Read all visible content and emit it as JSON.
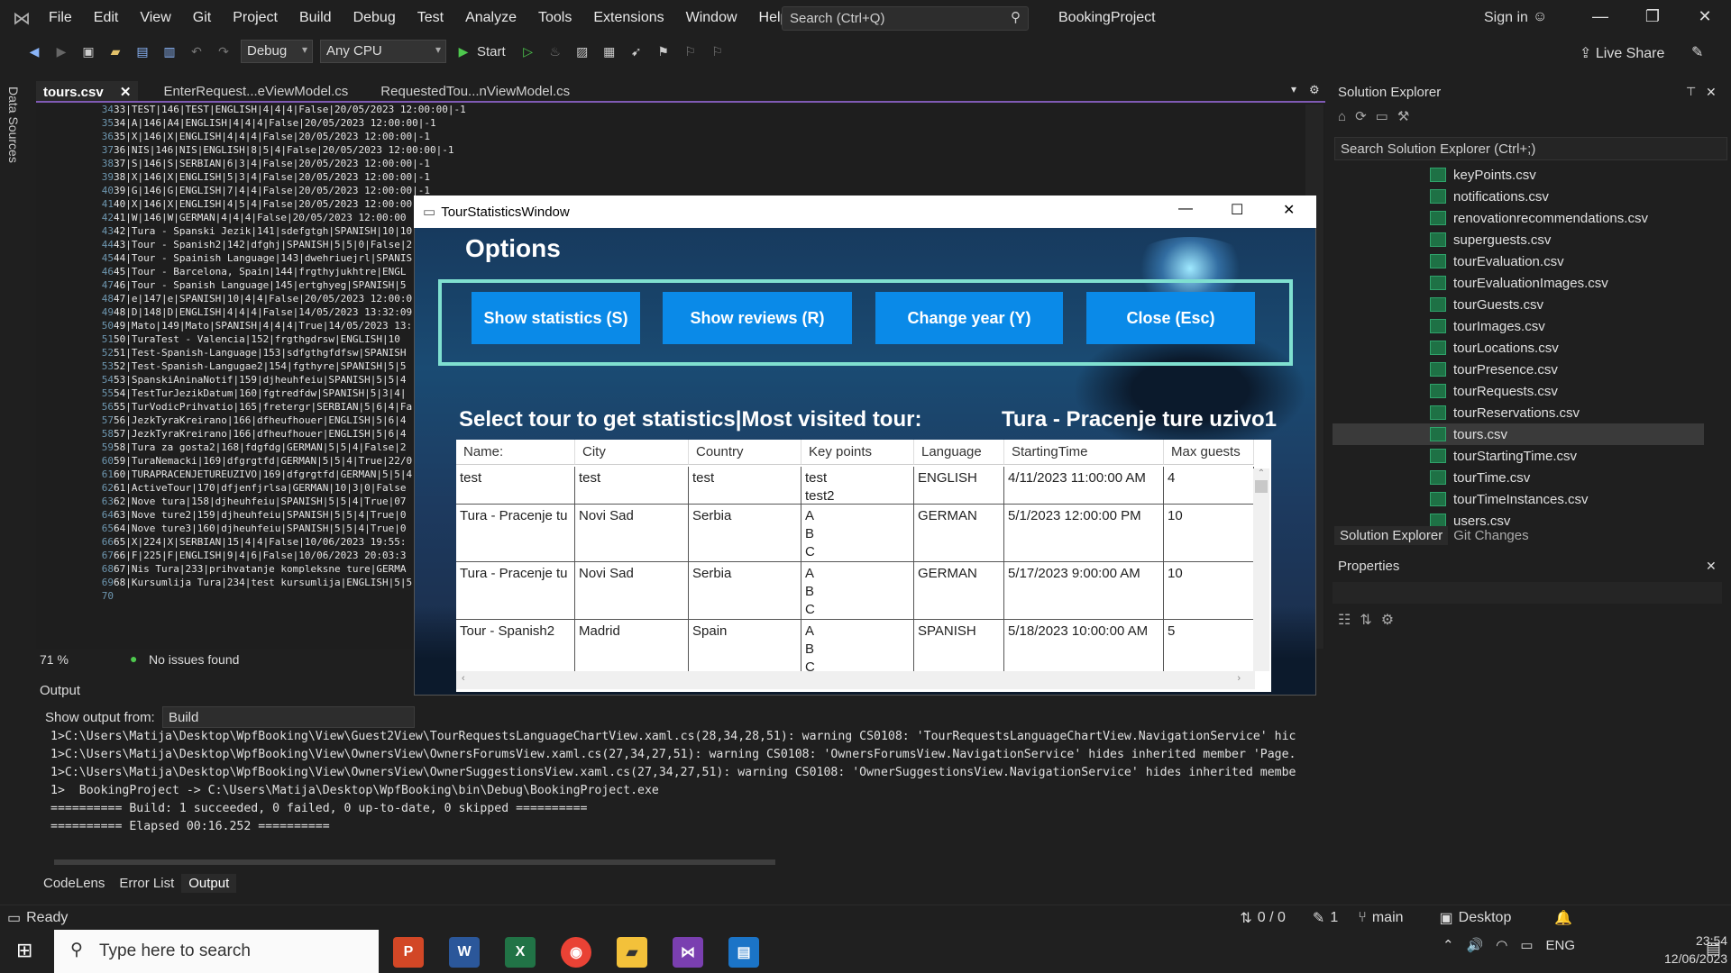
{
  "titlebar": {
    "menu": [
      "File",
      "Edit",
      "View",
      "Git",
      "Project",
      "Build",
      "Debug",
      "Test",
      "Analyze",
      "Tools",
      "Extensions",
      "Window",
      "Help"
    ],
    "search": "Search (Ctrl+Q)",
    "project": "BookingProject",
    "signin": "Sign in"
  },
  "toolbar": {
    "config": "Debug",
    "platform": "Any CPU",
    "start": "Start",
    "liveshare": "Live Share"
  },
  "sidebar": {
    "label": "Data Sources"
  },
  "tabs": [
    {
      "label": "tours.csv",
      "active": true
    },
    {
      "label": "EnterRequest...eViewModel.cs"
    },
    {
      "label": "RequestedTou...nViewModel.cs"
    }
  ],
  "editor": {
    "lines": [
      {
        "n": "34",
        "t": "33|TEST|146|TEST|ENGLISH|4|4|4|False|20/05/2023 12:00:00|-1"
      },
      {
        "n": "35",
        "t": "34|A|146|A4|ENGLISH|4|4|4|False|20/05/2023 12:00:00|-1"
      },
      {
        "n": "36",
        "t": "35|X|146|X|ENGLISH|4|4|4|False|20/05/2023 12:00:00|-1"
      },
      {
        "n": "37",
        "t": "36|NIS|146|NIS|ENGLISH|8|5|4|False|20/05/2023 12:00:00|-1"
      },
      {
        "n": "38",
        "t": "37|S|146|S|SERBIAN|6|3|4|False|20/05/2023 12:00:00|-1"
      },
      {
        "n": "39",
        "t": "38|X|146|X|ENGLISH|5|3|4|False|20/05/2023 12:00:00|-1"
      },
      {
        "n": "40",
        "t": "39|G|146|G|ENGLISH|7|4|4|False|20/05/2023 12:00:00|-1"
      },
      {
        "n": "41",
        "t": "40|X|146|X|ENGLISH|4|5|4|False|20/05/2023 12:00:00"
      },
      {
        "n": "42",
        "t": "41|W|146|W|GERMAN|4|4|4|False|20/05/2023 12:00:00"
      },
      {
        "n": "43",
        "t": "42|Tura - Spanski Jezik|141|sdefgtgh|SPANISH|10|10"
      },
      {
        "n": "44",
        "t": "43|Tour - Spanish2|142|dfghj|SPANISH|5|5|0|False|2"
      },
      {
        "n": "45",
        "t": "44|Tour - Spainish Language|143|dwehriuejrl|SPANIS"
      },
      {
        "n": "46",
        "t": "45|Tour - Barcelona, Spain|144|frgthyjukhtre|ENGL"
      },
      {
        "n": "47",
        "t": "46|Tour - Spanish Language|145|ertghyeg|SPANISH|5"
      },
      {
        "n": "48",
        "t": "47|e|147|e|SPANISH|10|4|4|False|20/05/2023 12:00:0"
      },
      {
        "n": "49",
        "t": "48|D|148|D|ENGLISH|4|4|4|False|14/05/2023 13:32:09"
      },
      {
        "n": "50",
        "t": "49|Mato|149|Mato|SPANISH|4|4|4|True|14/05/2023 13:"
      },
      {
        "n": "51",
        "t": "50|TuraTest - Valencia|152|frgthgdrsw|ENGLISH|10"
      },
      {
        "n": "52",
        "t": "51|Test-Spanish-Language|153|sdfgthgfdfsw|SPANISH"
      },
      {
        "n": "53",
        "t": "52|Test-Spanish-Langugae2|154|fgthyre|SPANISH|5|5"
      },
      {
        "n": "54",
        "t": "53|SpanskiAninaNotif|159|djheuhfeiu|SPANISH|5|5|4"
      },
      {
        "n": "55",
        "t": "54|TestTurJezikDatum|160|fgtredfdw|SPANISH|5|3|4|"
      },
      {
        "n": "56",
        "t": "55|TurVodicPrihvatio|165|fretergr|SERBIAN|5|6|4|Fa"
      },
      {
        "n": "57",
        "t": "56|JezkTyraKreirano|166|dfheufhouer|ENGLISH|5|6|4"
      },
      {
        "n": "58",
        "t": "57|JezkTyraKreirano|166|dfheufhouer|ENGLISH|5|6|4"
      },
      {
        "n": "59",
        "t": "58|Tura za gosta2|168|fdgfdg|GERMAN|5|5|4|False|2"
      },
      {
        "n": "60",
        "t": "59|TuraNemacki|169|dfgrgtfd|GERMAN|5|5|4|True|22/0"
      },
      {
        "n": "61",
        "t": "60|TURAPRACENJETUREUZIVO|169|dfgrgtfd|GERMAN|5|5|4"
      },
      {
        "n": "62",
        "t": "61|ActiveTour|170|dfjenfjrlsa|GERMAN|10|3|0|False"
      },
      {
        "n": "63",
        "t": "62|Nove tura|158|djheuhfeiu|SPANISH|5|5|4|True|07"
      },
      {
        "n": "64",
        "t": "63|Nove ture2|159|djheuhfeiu|SPANISH|5|5|4|True|0"
      },
      {
        "n": "65",
        "t": "64|Nove ture3|160|djheuhfeiu|SPANISH|5|5|4|True|0"
      },
      {
        "n": "66",
        "t": "65|X|224|X|SERBIAN|15|4|4|False|10/06/2023 19:55:"
      },
      {
        "n": "67",
        "t": "66|F|225|F|ENGLISH|9|4|6|False|10/06/2023 20:03:3"
      },
      {
        "n": "68",
        "t": "67|Nis Tura|233|prihvatanje kompleksne ture|GERMA"
      },
      {
        "n": "69",
        "t": "68|Kursumlija Tura|234|test kursumlija|ENGLISH|5|5"
      },
      {
        "n": "70",
        "t": ""
      }
    ],
    "zoom": "71 %",
    "issues": "No issues found"
  },
  "output": {
    "title": "Output",
    "show_from": "Show output from:",
    "source": "Build",
    "lines": [
      "1>C:\\Users\\Matija\\Desktop\\WpfBooking\\View\\Guest2View\\TourRequestsLanguageChartView.xaml.cs(28,34,28,51): warning CS0108: 'TourRequestsLanguageChartView.NavigationService' hic",
      "1>C:\\Users\\Matija\\Desktop\\WpfBooking\\View\\OwnersView\\OwnersForumsView.xaml.cs(27,34,27,51): warning CS0108: 'OwnersForumsView.NavigationService' hides inherited member 'Page.",
      "1>C:\\Users\\Matija\\Desktop\\WpfBooking\\View\\OwnersView\\OwnerSuggestionsView.xaml.cs(27,34,27,51): warning CS0108: 'OwnerSuggestionsView.NavigationService' hides inherited membe",
      "1>  BookingProject -> C:\\Users\\Matija\\Desktop\\WpfBooking\\bin\\Debug\\BookingProject.exe",
      "========== Build: 1 succeeded, 0 failed, 0 up-to-date, 0 skipped ==========",
      "========== Elapsed 00:16.252 =========="
    ]
  },
  "bottom_tabs": [
    "CodeLens",
    "Error List",
    "Output"
  ],
  "statusbar": {
    "ready": "Ready",
    "changes": "0 / 0",
    "commits": "1",
    "branch": "main",
    "target": "Desktop"
  },
  "solution": {
    "title": "Solution Explorer",
    "search": "Search Solution Explorer (Ctrl+;)",
    "files": [
      "keyPoints.csv",
      "notifications.csv",
      "renovationrecommendations.csv",
      "superguests.csv",
      "tourEvaluation.csv",
      "tourEvaluationImages.csv",
      "tourGuests.csv",
      "tourImages.csv",
      "tourLocations.csv",
      "tourPresence.csv",
      "tourRequests.csv",
      "tourReservations.csv",
      "tours.csv",
      "tourStartingTime.csv",
      "tourTime.csv",
      "tourTimeInstances.csv",
      "users.csv"
    ],
    "selected": "tours.csv",
    "tabs": [
      "Solution Explorer",
      "Git Changes"
    ]
  },
  "properties": {
    "title": "Properties"
  },
  "dialog": {
    "title": "TourStatisticsWindow",
    "options": "Options",
    "buttons": [
      "Show statistics (S)",
      "Show reviews (R)",
      "Change year (Y)",
      "Close (Esc)"
    ],
    "select_label": "Select tour to get statistics|Most visited tour:",
    "most_visited": "Tura - Pracenje ture uzivo1",
    "columns": [
      "Name:",
      "City",
      "Country",
      "Key points",
      "Language",
      "StartingTime",
      "Max guests"
    ],
    "rows": [
      {
        "name": "test",
        "city": "test",
        "country": "test",
        "kp": "test\ntest2",
        "lang": "ENGLISH",
        "start": "4/11/2023 11:00:00 AM",
        "max": "4"
      },
      {
        "name": "Tura - Pracenje tu",
        "city": "Novi Sad",
        "country": "Serbia",
        "kp": "A\nB\nC",
        "lang": "GERMAN",
        "start": "5/1/2023 12:00:00 PM",
        "max": "10"
      },
      {
        "name": "Tura - Pracenje tu",
        "city": "Novi Sad",
        "country": "Serbia",
        "kp": "A\nB\nC",
        "lang": "GERMAN",
        "start": "5/17/2023 9:00:00 AM",
        "max": "10"
      },
      {
        "name": "Tour - Spanish2",
        "city": "Madrid",
        "country": "Spain",
        "kp": "A\nB\nC",
        "lang": "SPANISH",
        "start": "5/18/2023 10:00:00 AM",
        "max": "5"
      }
    ]
  },
  "taskbar": {
    "search": "Type here to search",
    "lang": "ENG",
    "time": "23:54",
    "date": "12/06/2023",
    "notif": "2"
  }
}
